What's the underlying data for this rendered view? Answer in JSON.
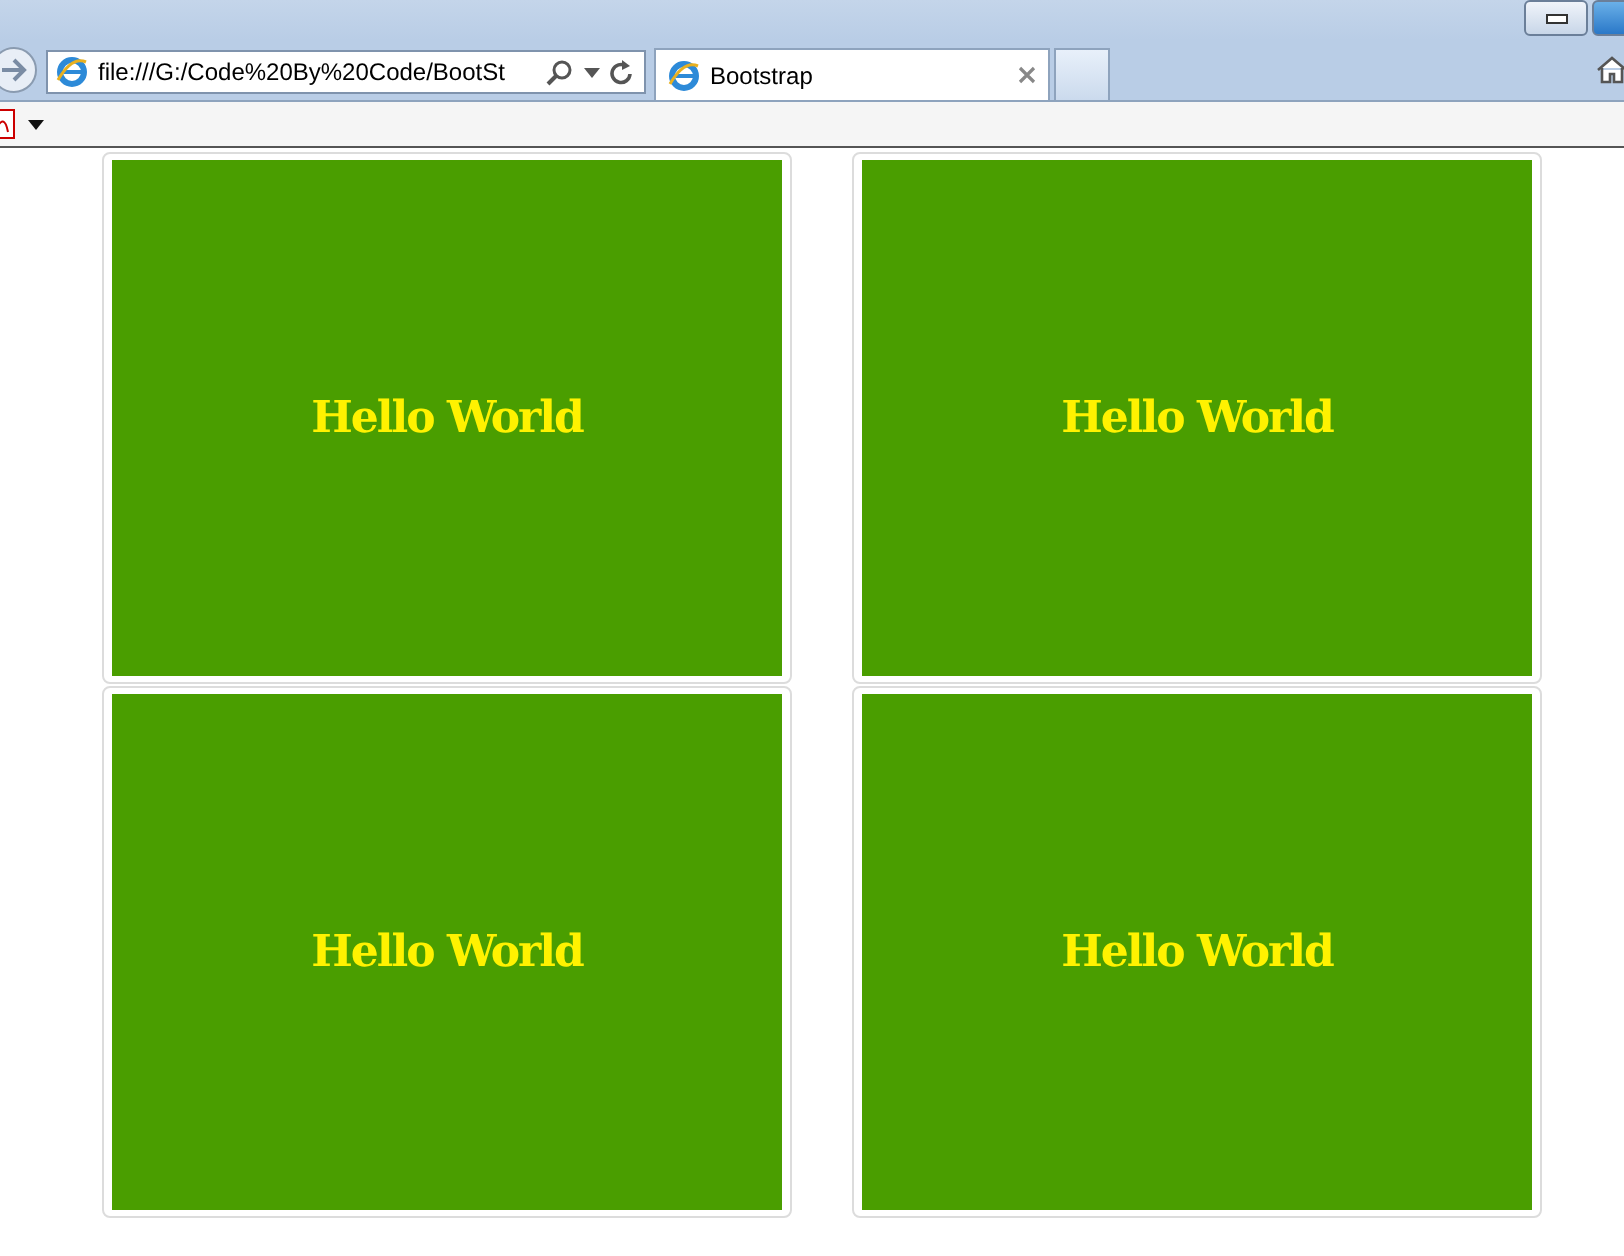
{
  "address_bar": {
    "value": "file:///G:/Code%20By%20Code/BootSt"
  },
  "tabs": [
    {
      "title": "Bootstrap",
      "selected": true
    }
  ],
  "thumbnails": [
    {
      "caption": "Hello World"
    },
    {
      "caption": "Hello World"
    },
    {
      "caption": "Hello World"
    },
    {
      "caption": "Hello World"
    }
  ]
}
